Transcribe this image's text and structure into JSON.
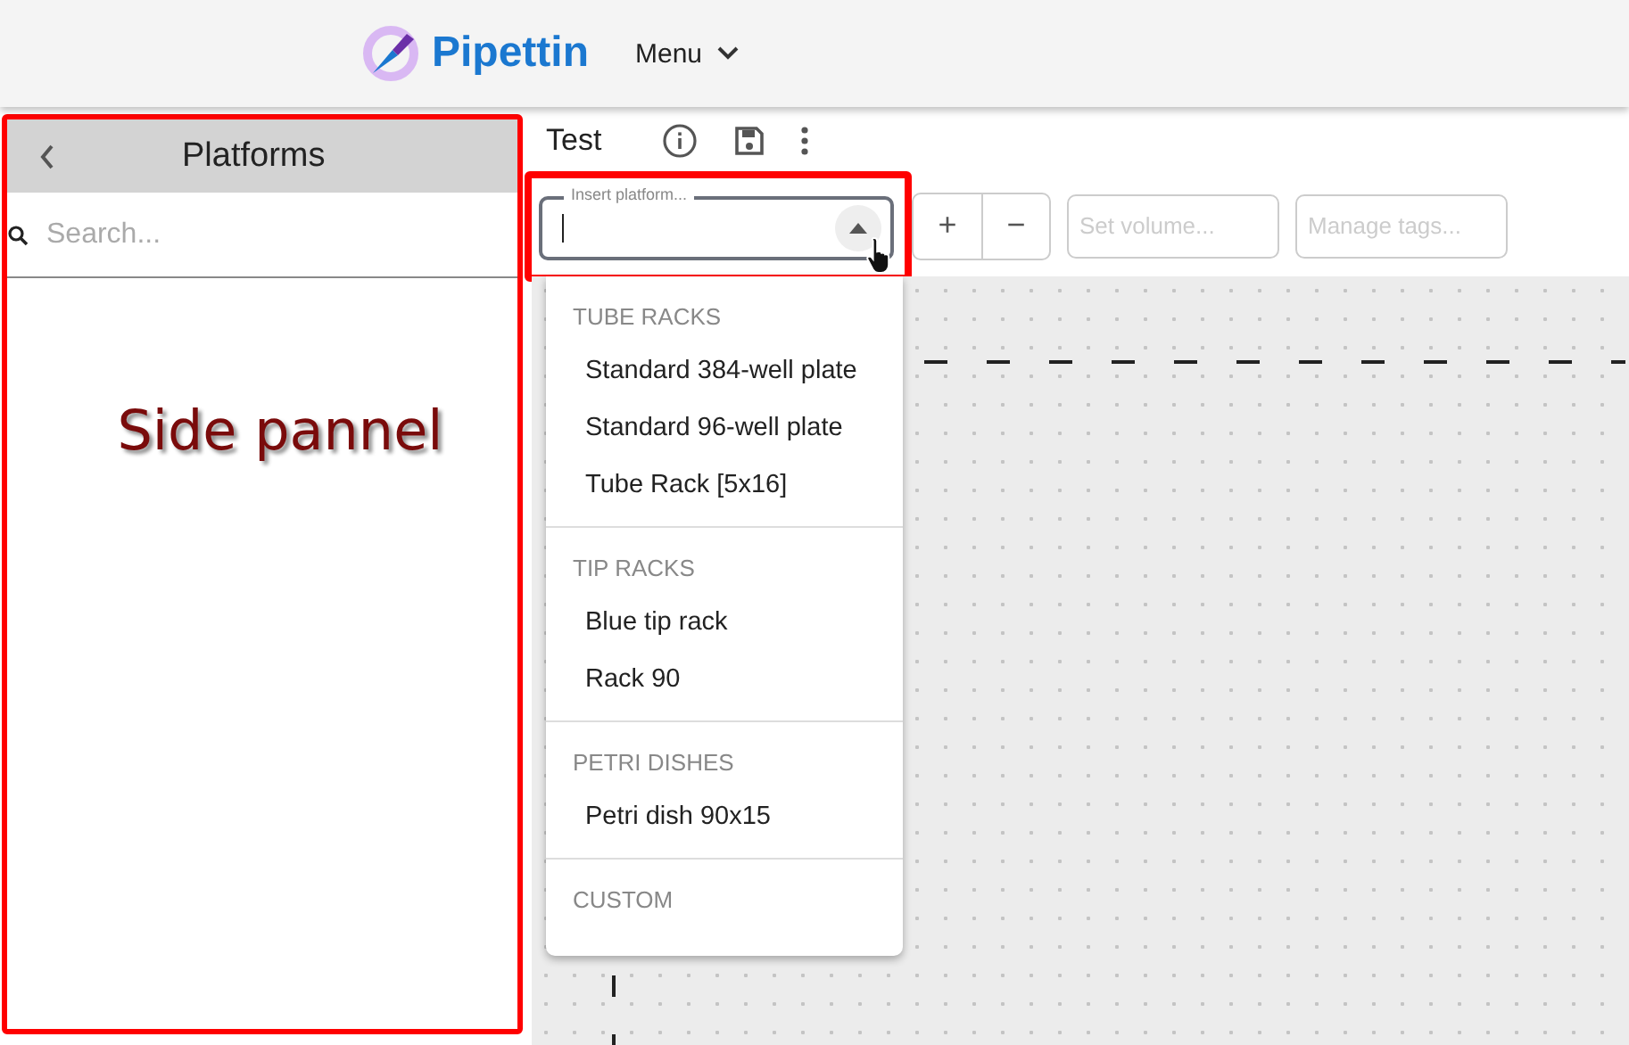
{
  "header": {
    "brand": "Pipettin",
    "menu": "Menu"
  },
  "side_panel": {
    "title": "Platforms",
    "search": {
      "placeholder": "Search..."
    }
  },
  "toolbar": {
    "title": "Test",
    "platform_field": {
      "label": "Insert platform...",
      "expanded": true
    },
    "volume": {
      "placeholder": "Set volume..."
    },
    "tags": {
      "placeholder": "Manage tags..."
    },
    "plus": "+",
    "minus": "−"
  },
  "dropdown": [
    {
      "group": "TUBE RACKS",
      "items": [
        "Standard 384-well plate",
        "Standard 96-well plate",
        "Tube Rack [5x16]"
      ]
    },
    {
      "group": "TIP RACKS",
      "items": [
        "Blue tip rack",
        "Rack 90"
      ]
    },
    {
      "group": "PETRI DISHES",
      "items": [
        "Petri dish 90x15"
      ]
    },
    {
      "group": "CUSTOM"
    }
  ],
  "annotation": {
    "label": "Side pannel"
  }
}
